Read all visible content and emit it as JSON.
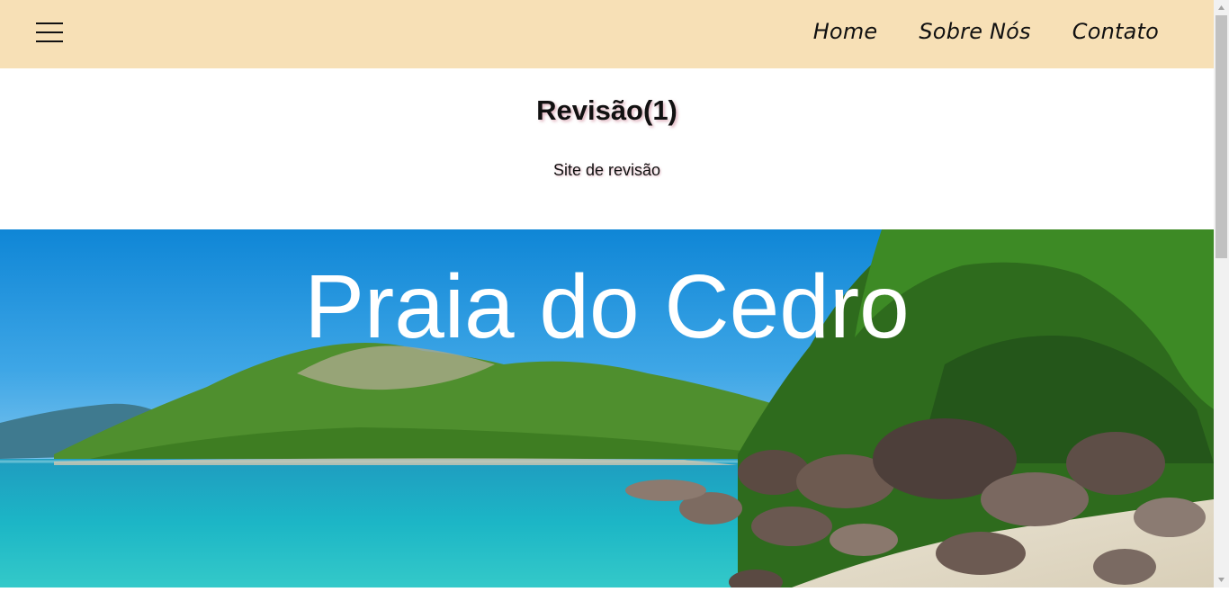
{
  "nav": {
    "menu_icon": "hamburger-menu-icon",
    "links": [
      "Home",
      "Sobre Nós",
      "Contato"
    ]
  },
  "intro": {
    "title": "Revisão(1)",
    "subtitle": "Site de revisão"
  },
  "hero": {
    "title": "Praia do Cedro"
  },
  "colors": {
    "navbar_bg": "#f7e0b6",
    "text": "#111111",
    "hero_text": "#ffffff"
  }
}
